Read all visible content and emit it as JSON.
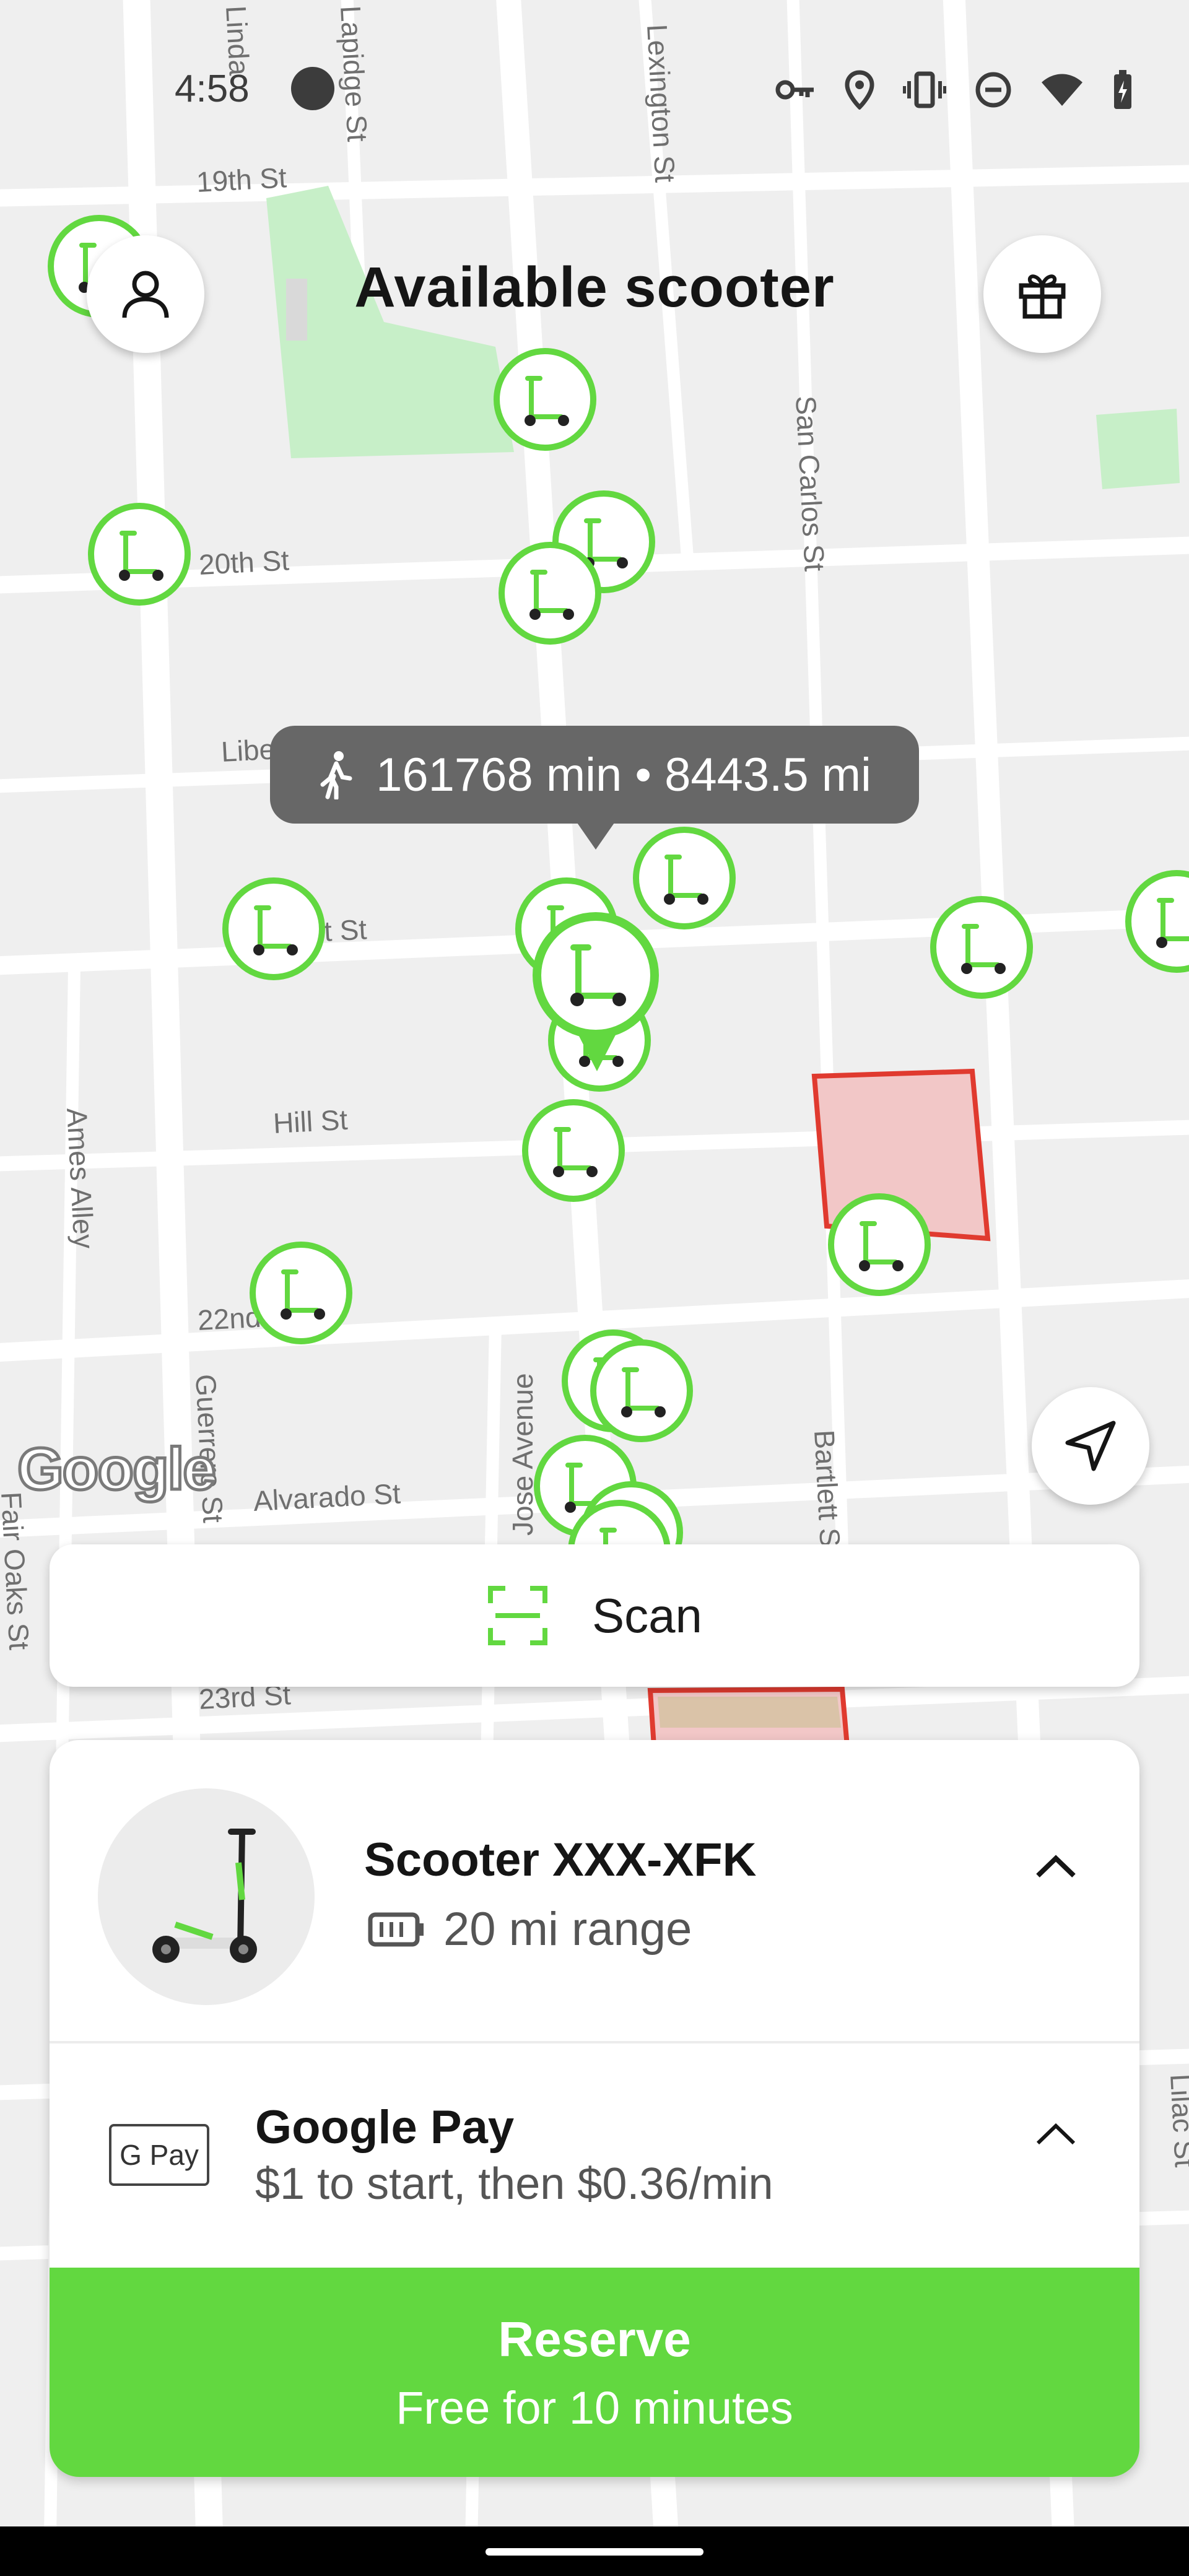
{
  "status_bar": {
    "time": "4:58",
    "icons": [
      "key-icon",
      "location-icon",
      "vibrate-icon",
      "do-not-disturb-icon",
      "wifi-icon",
      "battery-icon"
    ]
  },
  "header": {
    "title": "Available scooter",
    "profile_icon": "person-icon",
    "gift_icon": "gift-icon"
  },
  "map": {
    "street_labels": [
      "19th St",
      "20th St",
      "Libe",
      "t St",
      "Hill St",
      "22nd",
      "Alvarado St",
      "23rd St",
      "San Carlos St",
      "Lexington St",
      "Linda",
      "Lapidge St",
      "Ames Alley",
      "Guerrero St",
      "Jose Avenue",
      "Bartlett St",
      "Fair Oaks St",
      "Lilac St"
    ],
    "attribution": "Google",
    "tooltip": "161768 min • 8443.5 mi",
    "tooltip_icon": "walking-icon",
    "recenter_icon": "navigation-arrow-icon"
  },
  "scan": {
    "label": "Scan",
    "icon": "scan-frame-icon"
  },
  "vehicle": {
    "name": "Scooter XXX-XFK",
    "range": "20 mi range",
    "battery_icon": "battery-outline-icon"
  },
  "payment": {
    "badge": "G Pay",
    "method": "Google Pay",
    "pricing": "$1 to start, then $0.36/min"
  },
  "reserve": {
    "title": "Reserve",
    "subtitle": "Free for 10 minutes"
  },
  "colors": {
    "accent": "#62d840",
    "map_background": "#efefef",
    "tooltip_bg": "#676767",
    "zone_fill": "#f2c7c7",
    "zone_border": "#e03a2f",
    "park": "#c7efc8"
  }
}
